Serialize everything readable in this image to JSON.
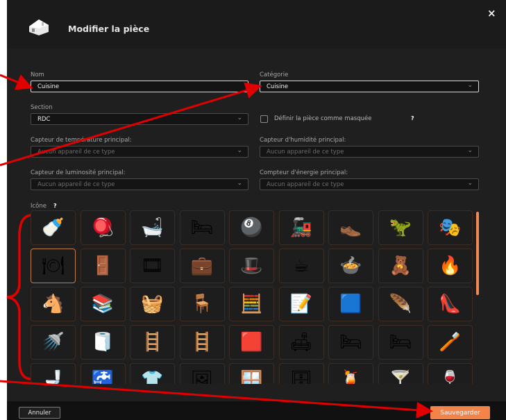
{
  "dialog": {
    "title": "Modifier la pièce",
    "close_glyph": "×",
    "house_icon": "house-icon"
  },
  "form": {
    "name": {
      "label": "Nom",
      "value": "Cuisine"
    },
    "category": {
      "label": "Catégorie",
      "value": "Cuisine"
    },
    "section": {
      "label": "Section",
      "value": "RDC"
    },
    "hidden": {
      "label": "Définir la pièce comme masquée",
      "help": "?",
      "checked": false
    },
    "temperature": {
      "label": "Capteur de température principal:",
      "placeholder": "Aucun appareil de ce type"
    },
    "humidity": {
      "label": "Capteur d'humidité principal:",
      "placeholder": "Aucun appareil de ce type"
    },
    "luminosity": {
      "label": "Capteur de luminosité principal:",
      "placeholder": "Aucun appareil de ce type"
    },
    "energy": {
      "label": "Compteur d'énergie principal:",
      "placeholder": "Aucun appareil de ce type"
    }
  },
  "icons": {
    "label": "Icône",
    "help": "?",
    "selected_index": 9,
    "items": [
      {
        "name": "pacifier-icon",
        "glyph": "🍼"
      },
      {
        "name": "spinning-top-icon",
        "glyph": "🪀"
      },
      {
        "name": "bathtub-icon",
        "glyph": "🛁"
      },
      {
        "name": "bed-icon",
        "glyph": "🛏"
      },
      {
        "name": "billiard-ball-icon",
        "glyph": "🎱"
      },
      {
        "name": "toy-train-icon",
        "glyph": "🚂"
      },
      {
        "name": "shoes-icon",
        "glyph": "👞"
      },
      {
        "name": "dinosaur-toy-icon",
        "glyph": "🦖"
      },
      {
        "name": "theater-icon",
        "glyph": "🎭"
      },
      {
        "name": "plate-icon",
        "glyph": "🍽"
      },
      {
        "name": "door-icon",
        "glyph": "🚪"
      },
      {
        "name": "film-reel-icon",
        "glyph": "🎞"
      },
      {
        "name": "suitcase-icon",
        "glyph": "💼"
      },
      {
        "name": "top-hat-icon",
        "glyph": "🎩"
      },
      {
        "name": "coffee-cup-icon",
        "glyph": "☕"
      },
      {
        "name": "cooking-pot-icon",
        "glyph": "🍲"
      },
      {
        "name": "stacking-toy-icon",
        "glyph": "🧸"
      },
      {
        "name": "fireplace-icon",
        "glyph": "🔥"
      },
      {
        "name": "rocking-horse-icon",
        "glyph": "🐴"
      },
      {
        "name": "books-icon",
        "glyph": "📚"
      },
      {
        "name": "laundry-basket-icon",
        "glyph": "🧺"
      },
      {
        "name": "armchair-icon",
        "glyph": "🪑"
      },
      {
        "name": "calculator-icon",
        "glyph": "🧮"
      },
      {
        "name": "notepad-icon",
        "glyph": "📝"
      },
      {
        "name": "cushion-icon",
        "glyph": "🟦"
      },
      {
        "name": "quill-icon",
        "glyph": "🪶"
      },
      {
        "name": "high-heels-icon",
        "glyph": "👠"
      },
      {
        "name": "shower-icon",
        "glyph": "🚿"
      },
      {
        "name": "towel-icon",
        "glyph": "🧻"
      },
      {
        "name": "stairs-icon",
        "glyph": "🪜"
      },
      {
        "name": "staircase-icon",
        "glyph": "🪜"
      },
      {
        "name": "red-stairs-icon",
        "glyph": "🟥"
      },
      {
        "name": "sofa-icon",
        "glyph": "🛋"
      },
      {
        "name": "purple-bed-icon",
        "glyph": "🛏"
      },
      {
        "name": "blue-bed-icon",
        "glyph": "🛏"
      },
      {
        "name": "toothbrush-cup-icon",
        "glyph": "🪥"
      },
      {
        "name": "toilet-icon",
        "glyph": "🚽"
      },
      {
        "name": "sink-icon",
        "glyph": "🚰"
      },
      {
        "name": "wardrobe-rack-icon",
        "glyph": "👕"
      },
      {
        "name": "easel-icon",
        "glyph": "🖼"
      },
      {
        "name": "table-icon",
        "glyph": "🪟"
      },
      {
        "name": "closet-icon",
        "glyph": "🗄"
      },
      {
        "name": "cocktail-icon",
        "glyph": "🍹"
      },
      {
        "name": "margarita-icon",
        "glyph": "🍸"
      },
      {
        "name": "wine-rack-icon",
        "glyph": "🍷"
      }
    ]
  },
  "footer": {
    "cancel": "Annuler",
    "save": "Sauvegarder"
  },
  "colors": {
    "accent": "#f2844a",
    "annotation": "#e00000"
  }
}
